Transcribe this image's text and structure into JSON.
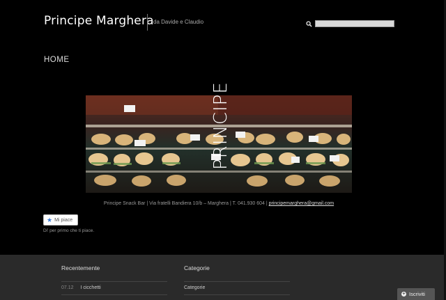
{
  "header": {
    "site_title": "Principe Marghera",
    "tagline": "da Davide e Claudio",
    "search_placeholder": ""
  },
  "nav": {
    "home_label": "HOME"
  },
  "banner": {
    "logo_text": "PRINCIPE"
  },
  "footer_info": {
    "text": "Principe Snack Bar | Via fratelli Bandiera 10/b – Marghera | T. 041.930 604 |",
    "email": "principemarghera@gmail.com"
  },
  "social": {
    "like_label": "Mi piace",
    "like_hint": "Di' per primo che ti piace."
  },
  "widgets": {
    "recent_title": "Recentemente",
    "recent_items": [
      {
        "date": "07.12",
        "title": "I cicchetti"
      }
    ],
    "categories_title": "Categorie",
    "categories_items": [
      "Categorie"
    ]
  },
  "subscribe_label": "Iscriviti",
  "colors": {
    "background": "#000000",
    "panel": "#2a2a2a",
    "link": "#dddddd"
  }
}
